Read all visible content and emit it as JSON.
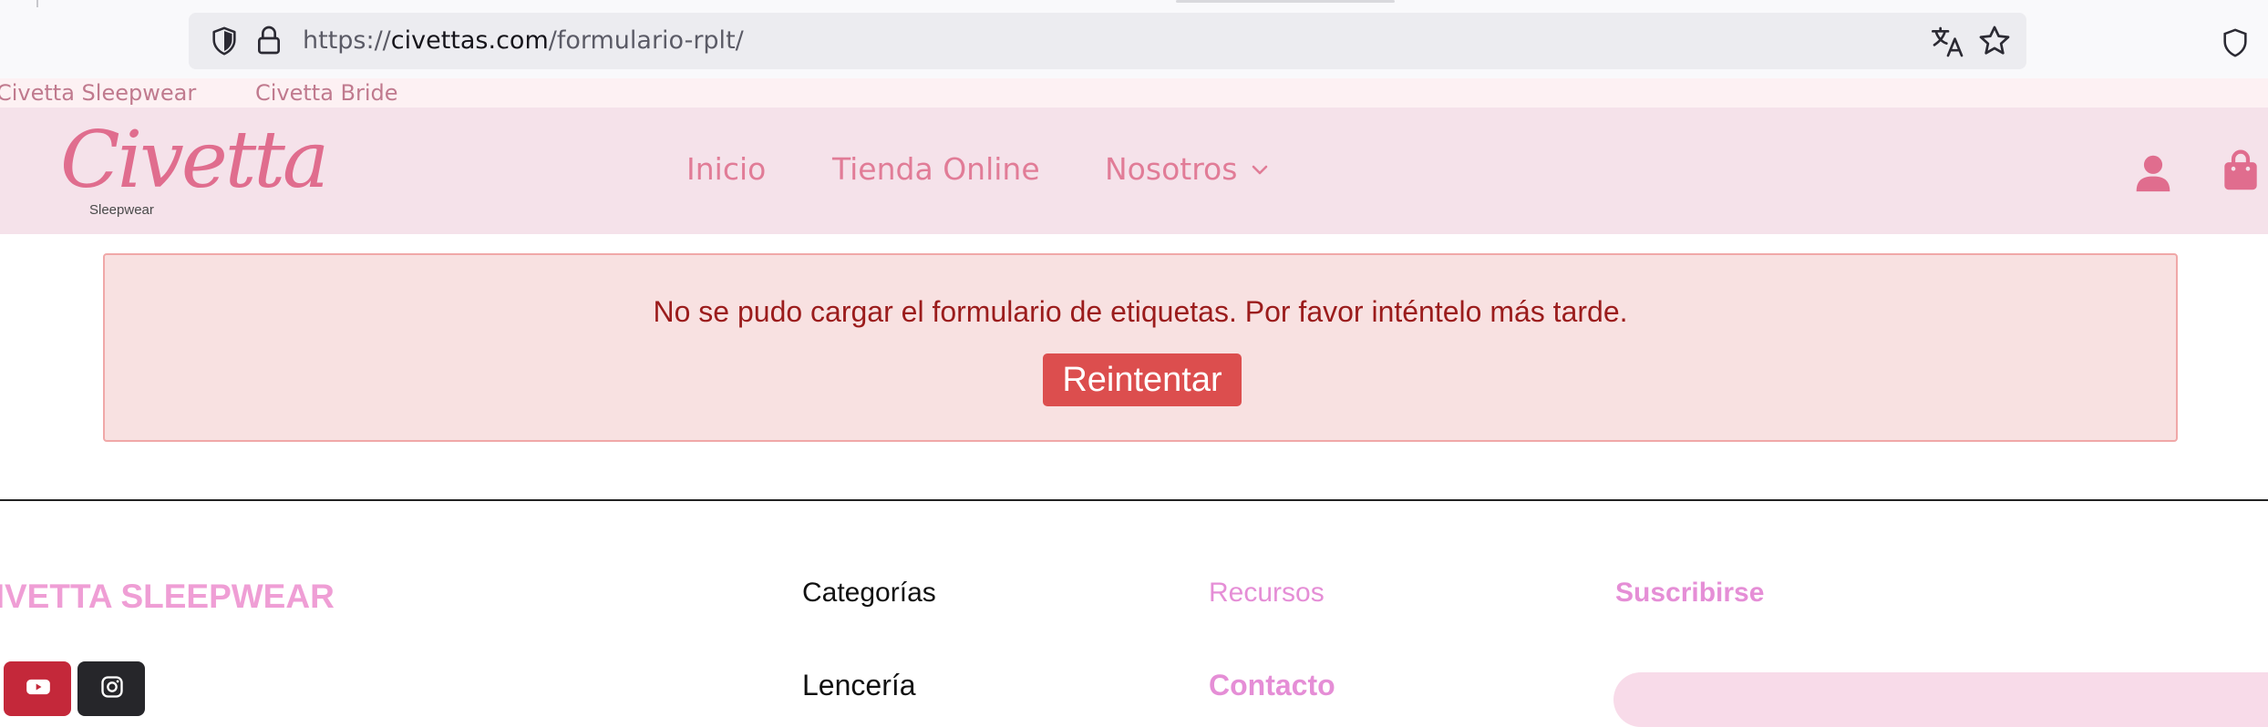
{
  "browser": {
    "url_scheme": "https://",
    "url_domain": "civettas.com",
    "url_path": "/formulario-rplt/"
  },
  "top_links": {
    "sleepwear": "Civetta Sleepwear",
    "bride": "Civetta Bride"
  },
  "header": {
    "logo_text": "Civetta",
    "logo_subtext": "Sleepwear",
    "nav": {
      "inicio": "Inicio",
      "tienda": "Tienda Online",
      "nosotros": "Nosotros"
    }
  },
  "error": {
    "message": "No se pudo cargar el formulario de etiquetas. Por favor inténtelo más tarde.",
    "retry_label": "Reintentar"
  },
  "footer": {
    "brand": "CIVETTA SLEEPWEAR",
    "categorias_heading": "Categorías",
    "recursos_heading": "Recursos",
    "suscribirse_heading": "Suscribirse",
    "lenceria_link": "Lencería",
    "contacto_link": "Contacto"
  },
  "colors": {
    "accent_pink": "#e17c97",
    "error_text": "#9b1c1c",
    "retry_button": "#dc4e4e",
    "footer_pink": "#e58ed6"
  }
}
